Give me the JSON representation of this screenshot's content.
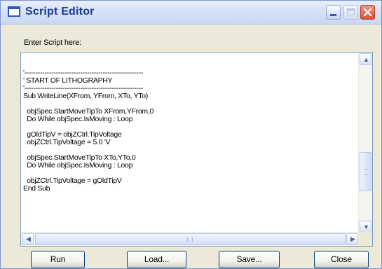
{
  "window": {
    "title": "Script Editor"
  },
  "editor": {
    "prompt": "Enter Script here:",
    "lines": [
      "",
      "'-----------------------------------------------------",
      "' START OF LITHOGRAPHY",
      "'-----------------------------------------------------",
      "Sub WriteLine(XFrom, YFrom, XTo, YTo)",
      "",
      "  objSpec.StartMoveTipTo XFrom,YFrom,0",
      "  Do While objSpec.IsMoving : Loop",
      "",
      "  gOldTipV = objZCtrl.TipVoltage",
      "  objZCtrl.TipVoltage = 5.0 'V",
      "",
      "  objSpec.StartMoveTipTo XTo,YTo,0",
      "  Do While objSpec.IsMoving : Loop",
      "",
      "  objZCtrl.TipVoltage = gOldTipV",
      "End Sub",
      "",
      "",
      "",
      ""
    ]
  },
  "buttons": {
    "run": "Run",
    "load": "Load...",
    "save": "Save...",
    "close": "Close"
  }
}
